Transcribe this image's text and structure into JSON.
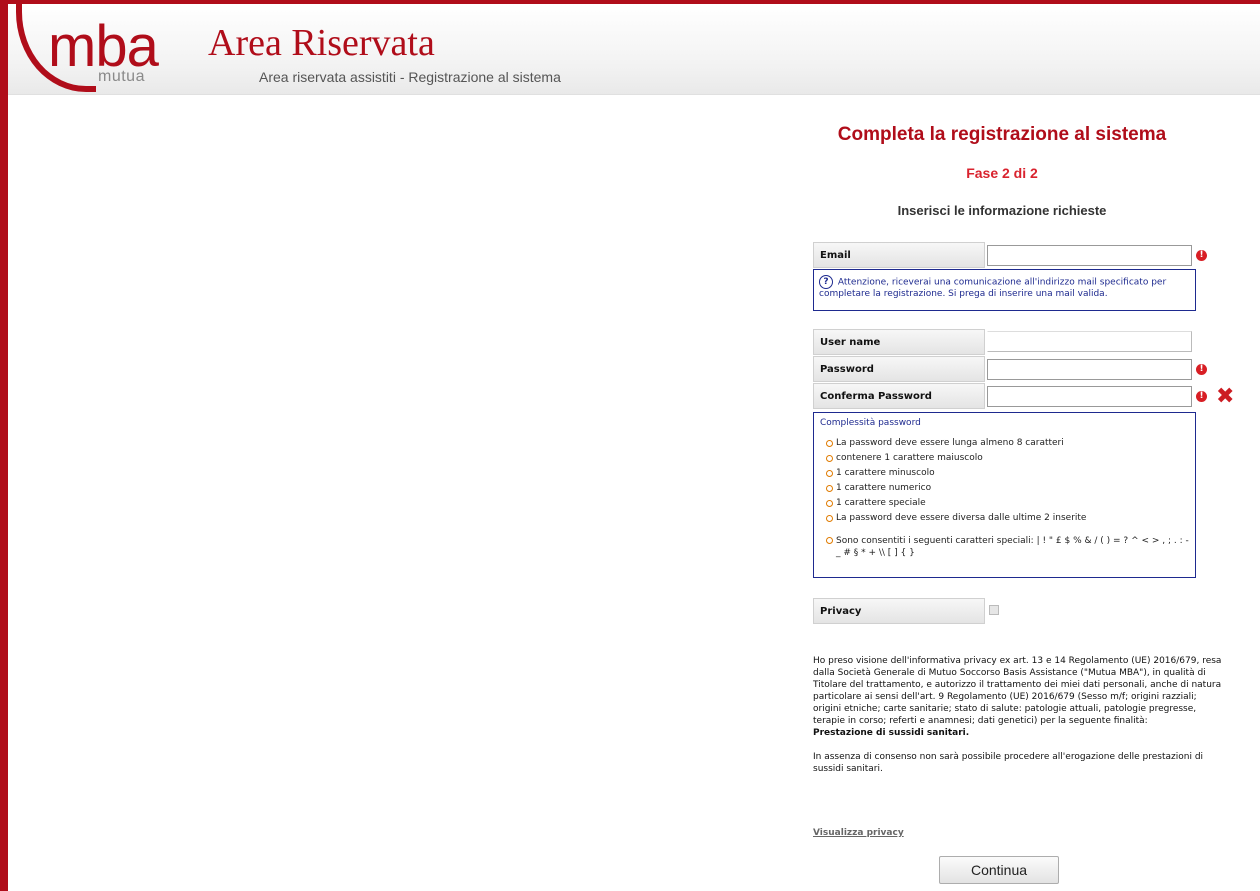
{
  "header": {
    "logo_text": "mba",
    "logo_sub": "mutua",
    "title": "Area Riservata",
    "subtitle": "Area riservata assistiti - Registrazione al sistema"
  },
  "form": {
    "heading": "Completa la registrazione al sistema",
    "phase": "Fase 2 di 2",
    "intro": "Inserisci le informazione richieste",
    "email_label": "Email",
    "email_value": "",
    "notice_icon": "?",
    "notice_text": "Attenzione, riceverai una comunicazione all'indirizzo mail specificato per completare la registrazione. Si prega di inserire una mail valida.",
    "username_label": "User name",
    "username_value": "",
    "password_label": "Password",
    "password_value": "",
    "confirm_label": "Conferma Password",
    "confirm_value": "",
    "required_mark": "!",
    "mismatch_mark": "✖"
  },
  "password_rules": {
    "title": "Complessità password",
    "items": [
      "La password deve essere lunga almeno 8 caratteri",
      "contenere 1 carattere maiuscolo",
      "1 carattere minuscolo",
      "1 carattere numerico",
      "1 carattere speciale",
      "La password deve essere diversa dalle ultime 2 inserite"
    ],
    "special_chars": "Sono consentiti i seguenti caratteri speciali: | ! \" £ $ % & / ( ) = ? ^ < > , ; . : - _ # § * + \\\\ [ ] { }"
  },
  "privacy": {
    "label": "Privacy",
    "checked": false,
    "paragraph1": "Ho preso visione dell'informativa privacy ex art. 13 e 14 Regolamento (UE) 2016/679, resa dalla Società Generale di Mutuo Soccorso Basis Assistance (\"Mutua MBA\"), in qualità di Titolare del trattamento, e autorizzo il trattamento dei miei dati personali, anche di natura particolare ai sensi dell'art. 9 Regolamento (UE) 2016/679 (Sesso m/f; origini razziali; origini etniche; carte sanitarie; stato di salute: patologie attuali, patologie pregresse, terapie in corso; referti e anamnesi; dati genetici) per la seguente finalità:",
    "paragraph1_bold": "Prestazione di sussidi sanitari.",
    "paragraph2": "In assenza di consenso non sarà possibile procedere all'erogazione delle prestazioni di sussidi sanitari.",
    "link": "Visualizza privacy"
  },
  "actions": {
    "continue": "Continua"
  },
  "colors": {
    "brand_red": "#b00d1a",
    "notice_blue": "#1e2a8f",
    "error_red": "#d81e24"
  }
}
